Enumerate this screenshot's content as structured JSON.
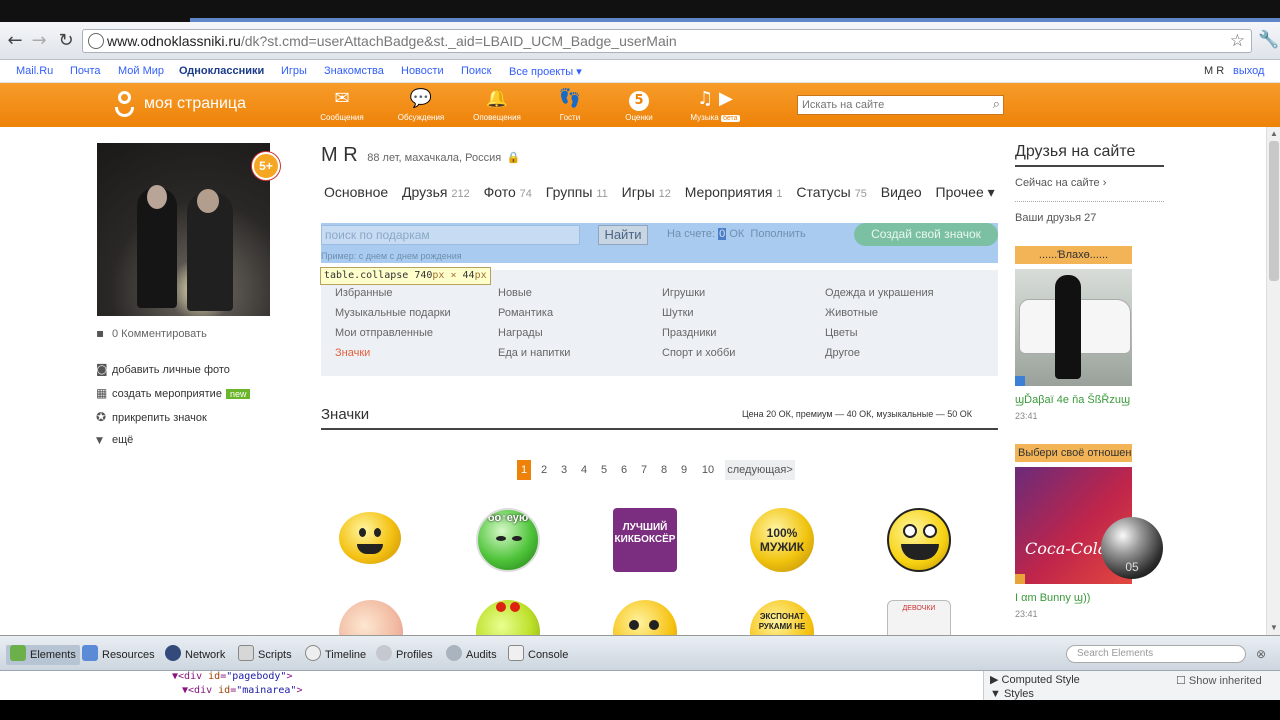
{
  "browser": {
    "url_host": "www.odnoklassniki.ru",
    "url_path": "/dk?st.cmd=userAttachBadge&st._aid=LBAID_UCM_Badge_userMain"
  },
  "portal": {
    "links": [
      "Mail.Ru",
      "Почта",
      "Мой Мир",
      "Одноклассники",
      "Игры",
      "Знакомства",
      "Новости",
      "Поиск",
      "Все проекты ▾"
    ],
    "user": "M R",
    "logout": "выход"
  },
  "header": {
    "brand": "моя страница",
    "nav": [
      {
        "label": "Сообщения",
        "icon": "envelope-icon",
        "glyph": "✉"
      },
      {
        "label": "Обсуждения",
        "icon": "discussions-icon",
        "glyph": "💬"
      },
      {
        "label": "Оповещения",
        "icon": "bell-icon",
        "glyph": "🔔"
      },
      {
        "label": "Гости",
        "icon": "footprints-icon",
        "glyph": "👣"
      },
      {
        "label": "Оценки",
        "icon": "rating-icon",
        "glyph": "5"
      },
      {
        "label": "Музыка",
        "icon": "music-icon",
        "glyph": "♫",
        "badge": "бета"
      }
    ],
    "search_placeholder": "Искать на сайте"
  },
  "profile": {
    "age_badge": "5+",
    "comment_link": "0 Комментировать",
    "actions": [
      {
        "label": "добавить личные фото",
        "icon": "camera-icon",
        "glyph": "◙"
      },
      {
        "label": "создать мероприятие",
        "icon": "calendar-icon",
        "glyph": "▦",
        "badge": "new"
      },
      {
        "label": "прикрепить значок",
        "icon": "badge-icon",
        "glyph": "✪"
      },
      {
        "label": "ещё",
        "icon": "triangle-down-icon",
        "glyph": "▼"
      }
    ],
    "name": "M R",
    "meta": "88 лет, махачкала, Россия",
    "tabs": [
      {
        "label": "Основное",
        "count": ""
      },
      {
        "label": "Друзья",
        "count": "212"
      },
      {
        "label": "Фото",
        "count": "74"
      },
      {
        "label": "Группы",
        "count": "11"
      },
      {
        "label": "Игры",
        "count": "12"
      },
      {
        "label": "Мероприятия",
        "count": "1"
      },
      {
        "label": "Статусы",
        "count": "75"
      },
      {
        "label": "Видео",
        "count": ""
      },
      {
        "label": "Прочее ▾",
        "count": ""
      }
    ]
  },
  "gifts": {
    "search_placeholder": "поиск по подаркам",
    "find_button": "Найти",
    "account_prefix": "На счете:",
    "account_value": "0",
    "account_suffix": "ОК",
    "topup": "Пополнить",
    "create_badge": "Создай свой значок",
    "example": "Пример: с днем с днем рождения",
    "tooltip_tag": "table.collapse",
    "tooltip_w": "740",
    "tooltip_unit1": "px",
    "tooltip_x": "×",
    "tooltip_h": "44",
    "tooltip_unit2": "px",
    "categories": [
      [
        "Избранные",
        "Музыкальные подарки",
        "Мои отправленные",
        "Значки"
      ],
      [
        "Новые",
        "Романтика",
        "Награды",
        "Еда и напитки"
      ],
      [
        "Игрушки",
        "Шутки",
        "Праздники",
        "Спорт и хобби"
      ],
      [
        "Одежда и украшения",
        "Животные",
        "Цветы",
        "Другое"
      ]
    ],
    "selected_category": "Значки"
  },
  "badges": {
    "title": "Значки",
    "price": "Цена 20 ОК, премиум — 40 ОК, музыкальные — 50 ОК",
    "pages": [
      "1",
      "2",
      "3",
      "4",
      "5",
      "6",
      "7",
      "8",
      "9",
      "10"
    ],
    "current_page": "1",
    "next": "следующая>",
    "labels": {
      "b2": "бо↑еую",
      "b3": "ЛУЧШИЙ КИКБОКСЁР",
      "b4": "100% МУЖИК",
      "b9": "ЭКСПОНАТ РУКАМИ НЕ",
      "b10": "ДЕВОЧКИ"
    }
  },
  "sidebar": {
    "title": "Друзья на сайте",
    "online_now": "Сейчас на сайте ›",
    "your_friends": "Ваши друзья 27",
    "friends": [
      {
        "header": "......Ɓлахө......",
        "name": "ϣĎаβаї 4е ňа ŠßŘzuϣ",
        "time": "23:41"
      },
      {
        "header": "Выбери своё отношение",
        "name": "I αm Bunny ϣ))",
        "time": "23:41",
        "photo_text": "Coca-Cola",
        "orb_text": "05"
      }
    ]
  },
  "devtools": {
    "tabs": [
      "Elements",
      "Resources",
      "Network",
      "Scripts",
      "Timeline",
      "Profiles",
      "Audits",
      "Console"
    ],
    "search_placeholder": "Search Elements",
    "line1_tag": "div",
    "line1_attr": "id",
    "line1_val": "\"pagebody\"",
    "line2_tag": "div",
    "line2_attr": "id",
    "line2_val": "\"mainarea\"",
    "computed": "Computed Style",
    "show_inherited": "Show inherited",
    "styles": "Styles"
  },
  "colors": {
    "ok_orange": "#ee8208",
    "link_blue": "#315efb"
  }
}
